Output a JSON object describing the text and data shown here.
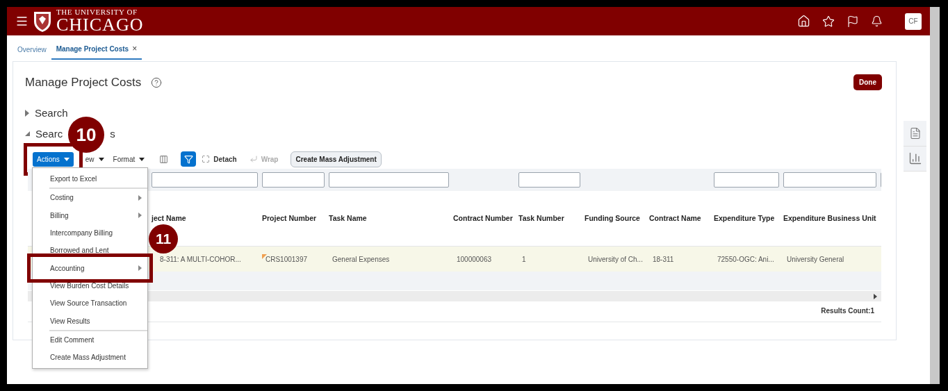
{
  "header": {
    "logo_small": "THE UNIVERSITY OF",
    "logo_large": "CHICAGO",
    "avatar": "CF"
  },
  "tabs": [
    {
      "label": "Overview",
      "selected": false
    },
    {
      "label": "Manage Project Costs",
      "selected": true,
      "close": "×"
    }
  ],
  "page": {
    "title": "Manage Project Costs",
    "done_button": "Done"
  },
  "sections": [
    {
      "parts": [
        "Search"
      ],
      "expanded": false
    },
    {
      "parts": [
        "Searc",
        "s"
      ],
      "expanded": true
    }
  ],
  "toolbar": [
    {
      "kind": "primary",
      "label": "Actions",
      "highlighted": true
    },
    {
      "kind": "menu",
      "label": "ew"
    },
    {
      "kind": "menu",
      "label": "Format"
    },
    {
      "kind": "freeze"
    },
    {
      "kind": "filter",
      "selected": true
    },
    {
      "kind": "detach",
      "label": "Detach",
      "disabled": false
    },
    {
      "kind": "wrap",
      "label": "Wrap",
      "disabled": true
    },
    {
      "kind": "button",
      "label": "Create Mass Adjustment"
    }
  ],
  "table": {
    "columns": [
      {
        "label": "ject Name",
        "filter": true
      },
      {
        "label": "Project Number",
        "filter": true
      },
      {
        "label": "Task Name",
        "filter": true
      },
      {
        "label": "Contract Number",
        "filter": false
      },
      {
        "label": "Task Number",
        "filter": true
      },
      {
        "label": "Funding Source",
        "filter": false
      },
      {
        "label": "Contract Name",
        "filter": false
      },
      {
        "label": "Expenditure Type",
        "filter": true
      },
      {
        "label": "Expenditure Business Unit",
        "filter": true
      }
    ],
    "rows": [
      {
        "selected": true,
        "cells": [
          {
            "text": "8-311: A MULTI-COHOR...",
            "flag": false
          },
          {
            "text": "CRS1001397",
            "flag": true
          },
          {
            "text": "General Expenses",
            "flag": false
          },
          {
            "text": "100000063",
            "flag": false
          },
          {
            "text": "1",
            "flag": false
          },
          {
            "text": "University of Ch...",
            "flag": false
          },
          {
            "text": "18-311",
            "flag": false
          },
          {
            "text": "72550-OGC: Ani...",
            "flag": false
          },
          {
            "text": "University General",
            "flag": false
          }
        ]
      }
    ],
    "results_count": "Results Count:1"
  },
  "menu": {
    "groups": [
      [
        {
          "label": "Export to Excel",
          "submenu": false,
          "highlighted": false
        }
      ],
      [
        {
          "label": "Costing",
          "submenu": true,
          "highlighted": false
        },
        {
          "label": "Billing",
          "submenu": true,
          "highlighted": false
        },
        {
          "label": "Intercompany Billing",
          "submenu": false,
          "highlighted": false
        },
        {
          "label": "Borrowed and Lent",
          "submenu": false,
          "highlighted": false
        },
        {
          "label": "Accounting",
          "submenu": true,
          "highlighted": true
        },
        {
          "label": "View Burden Cost Details",
          "submenu": false,
          "highlighted": false
        },
        {
          "label": "View Source Transaction",
          "submenu": false,
          "highlighted": false
        },
        {
          "label": "View Results",
          "submenu": false,
          "highlighted": false
        }
      ],
      [
        {
          "label": "Edit Comment",
          "submenu": false,
          "highlighted": false
        },
        {
          "label": "Create Mass Adjustment",
          "submenu": false,
          "highlighted": false
        }
      ]
    ]
  },
  "callouts": [
    {
      "number": "10"
    },
    {
      "number": "11"
    }
  ]
}
